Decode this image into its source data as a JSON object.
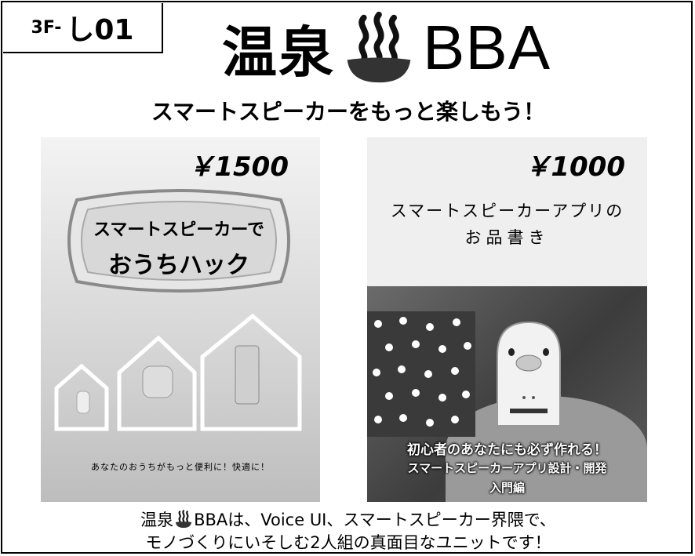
{
  "booth": {
    "prefix": "3F-",
    "code": "し01"
  },
  "title": {
    "jp": "温泉",
    "icon": "onsen-icon",
    "en": "BBA"
  },
  "subtitle": "スマートスピーカーをもっと楽しもう！",
  "books": [
    {
      "price": "￥1500",
      "title_line1": "スマートスピーカーで",
      "title_line2": "おうちハック",
      "tagline": "あなたのおうちがもっと便利に！快適に！"
    },
    {
      "price": "￥1000",
      "title_line1": "スマートスピーカーアプリの",
      "title_line2": "お品書き",
      "cover_line1": "初心者のあなたにも必ず作れる！",
      "cover_line2": "スマートスピーカーアプリ設計・開発",
      "cover_line3": "入門編"
    }
  ],
  "description": {
    "line1_before": "温泉",
    "line1_after": "BBAは、Voice UI、スマートスピーカー界隈で、",
    "line2": "モノづくりにいそしむ2人組の真面目なユニットです！"
  }
}
